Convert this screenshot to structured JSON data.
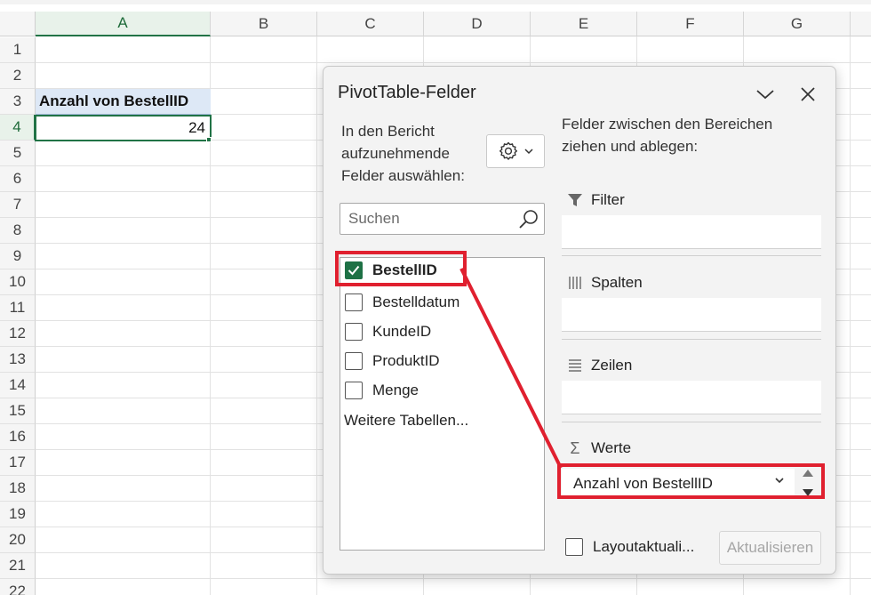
{
  "sheet": {
    "columns": [
      "A",
      "B",
      "C",
      "D",
      "E",
      "F",
      "G"
    ],
    "rows": [
      "1",
      "2",
      "3",
      "4",
      "5",
      "6",
      "7",
      "8",
      "9",
      "10",
      "11",
      "12",
      "13",
      "14",
      "15",
      "16",
      "17",
      "18",
      "19",
      "20",
      "21",
      "22"
    ],
    "active_column": "A",
    "active_row": "4",
    "cell_a3": "Anzahl von BestellID",
    "cell_a4": "24"
  },
  "panel": {
    "title": "PivotTable-Felder",
    "left_instructions": [
      "In den Bericht",
      "aufzunehmende",
      "Felder auswählen:"
    ],
    "search_placeholder": "Suchen",
    "fields": [
      {
        "label": "BestellID",
        "checked": true
      },
      {
        "label": "Bestelldatum",
        "checked": false
      },
      {
        "label": "KundeID",
        "checked": false
      },
      {
        "label": "ProduktID",
        "checked": false
      },
      {
        "label": "Menge",
        "checked": false
      }
    ],
    "more_tables": "Weitere Tabellen...",
    "right_instructions": [
      "Felder zwischen den Bereichen",
      "ziehen und ablegen:"
    ],
    "areas": {
      "filter": "Filter",
      "columns": "Spalten",
      "rows": "Zeilen",
      "values": "Werte"
    },
    "value_field": "Anzahl von BestellID",
    "defer_label": "Layoutaktuali...",
    "update_button": "Aktualisieren"
  },
  "colors": {
    "accent_green": "#217346",
    "checkbox_green": "#1e7145",
    "highlight_red": "#e0202f",
    "selection_blue": "#dde8f6"
  },
  "icons": [
    "gear-icon",
    "chevron-down-icon",
    "close-icon",
    "search-icon",
    "filter-icon",
    "columns-icon",
    "rows-icon",
    "sigma-icon",
    "spin-up-icon",
    "spin-down-icon"
  ]
}
